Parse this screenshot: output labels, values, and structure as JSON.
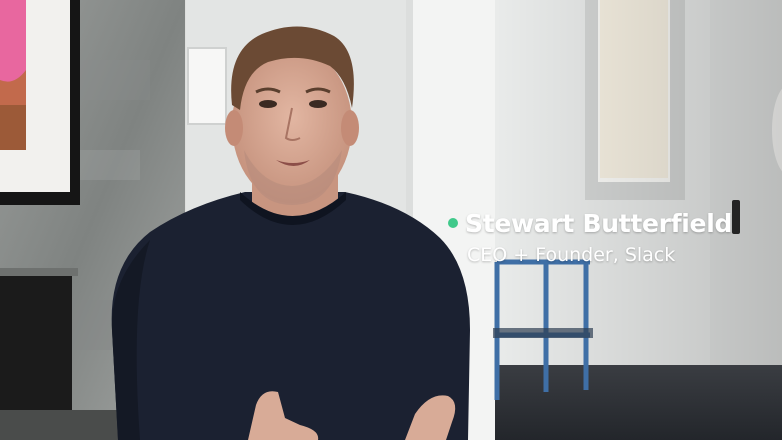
{
  "lower_third": {
    "name": "Stewart Butterfield",
    "role": "CEO + Founder, Slack",
    "dot_color": "#3fc98a"
  },
  "palette": {
    "wall": "#e7e8e6",
    "concrete": "#8f9290",
    "sweater": "#1b2131",
    "skin": "#d6a793",
    "hair": "#6b4a34",
    "floor": "#2c2f34",
    "chair_frame": "#3f6fa6"
  }
}
